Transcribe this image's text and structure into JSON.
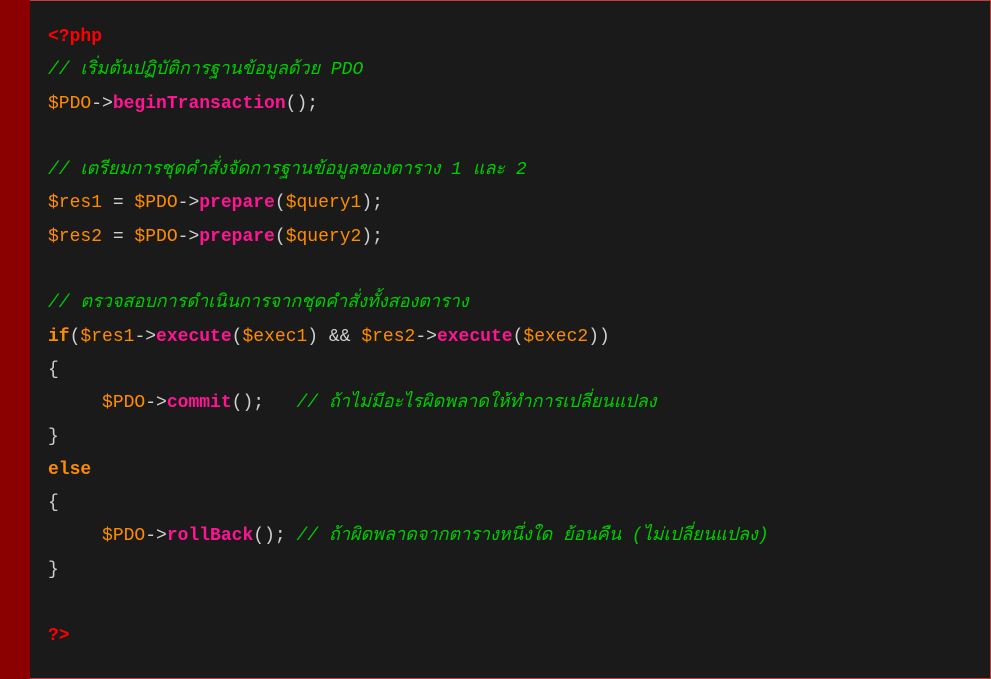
{
  "code": {
    "open_tag": "<?php",
    "close_tag": "?>",
    "comment1": "// เริ่มต้นปฏิบัติการฐานข้อมูลด้วย PDO",
    "line_pdo_begin_var": "$PDO",
    "arrow": "->",
    "method_begin": "beginTransaction",
    "paren_open": "(",
    "paren_close": ")",
    "semicolon": ";",
    "comment2": "// เตรียมการชุดคำสั่งจัดการฐานข้อมูลของตาราง 1 และ 2",
    "var_res1": "$res1",
    "var_res2": "$res2",
    "equals": " = ",
    "var_pdo": "$PDO",
    "method_prepare": "prepare",
    "var_query1": "$query1",
    "var_query2": "$query2",
    "comment3": "// ตรวจสอบการดำเนินการจากชุดคำสั่งทั้งสองตาราง",
    "keyword_if": "if",
    "method_execute": "execute",
    "var_exec1": "$exec1",
    "var_exec2": "$exec2",
    "op_and": " && ",
    "brace_open": "{",
    "brace_close": "}",
    "method_commit": "commit",
    "comment4": "// ถ้าไม่มีอะไรผิดพลาดให้ทำการเปลี่ยนแปลง",
    "keyword_else": "else",
    "method_rollback": "rollBack",
    "comment5": "// ถ้าผิดพลาดจากตารางหนึ่งใด ย้อนคืน (ไม่เปลี่ยนแปลง)"
  }
}
